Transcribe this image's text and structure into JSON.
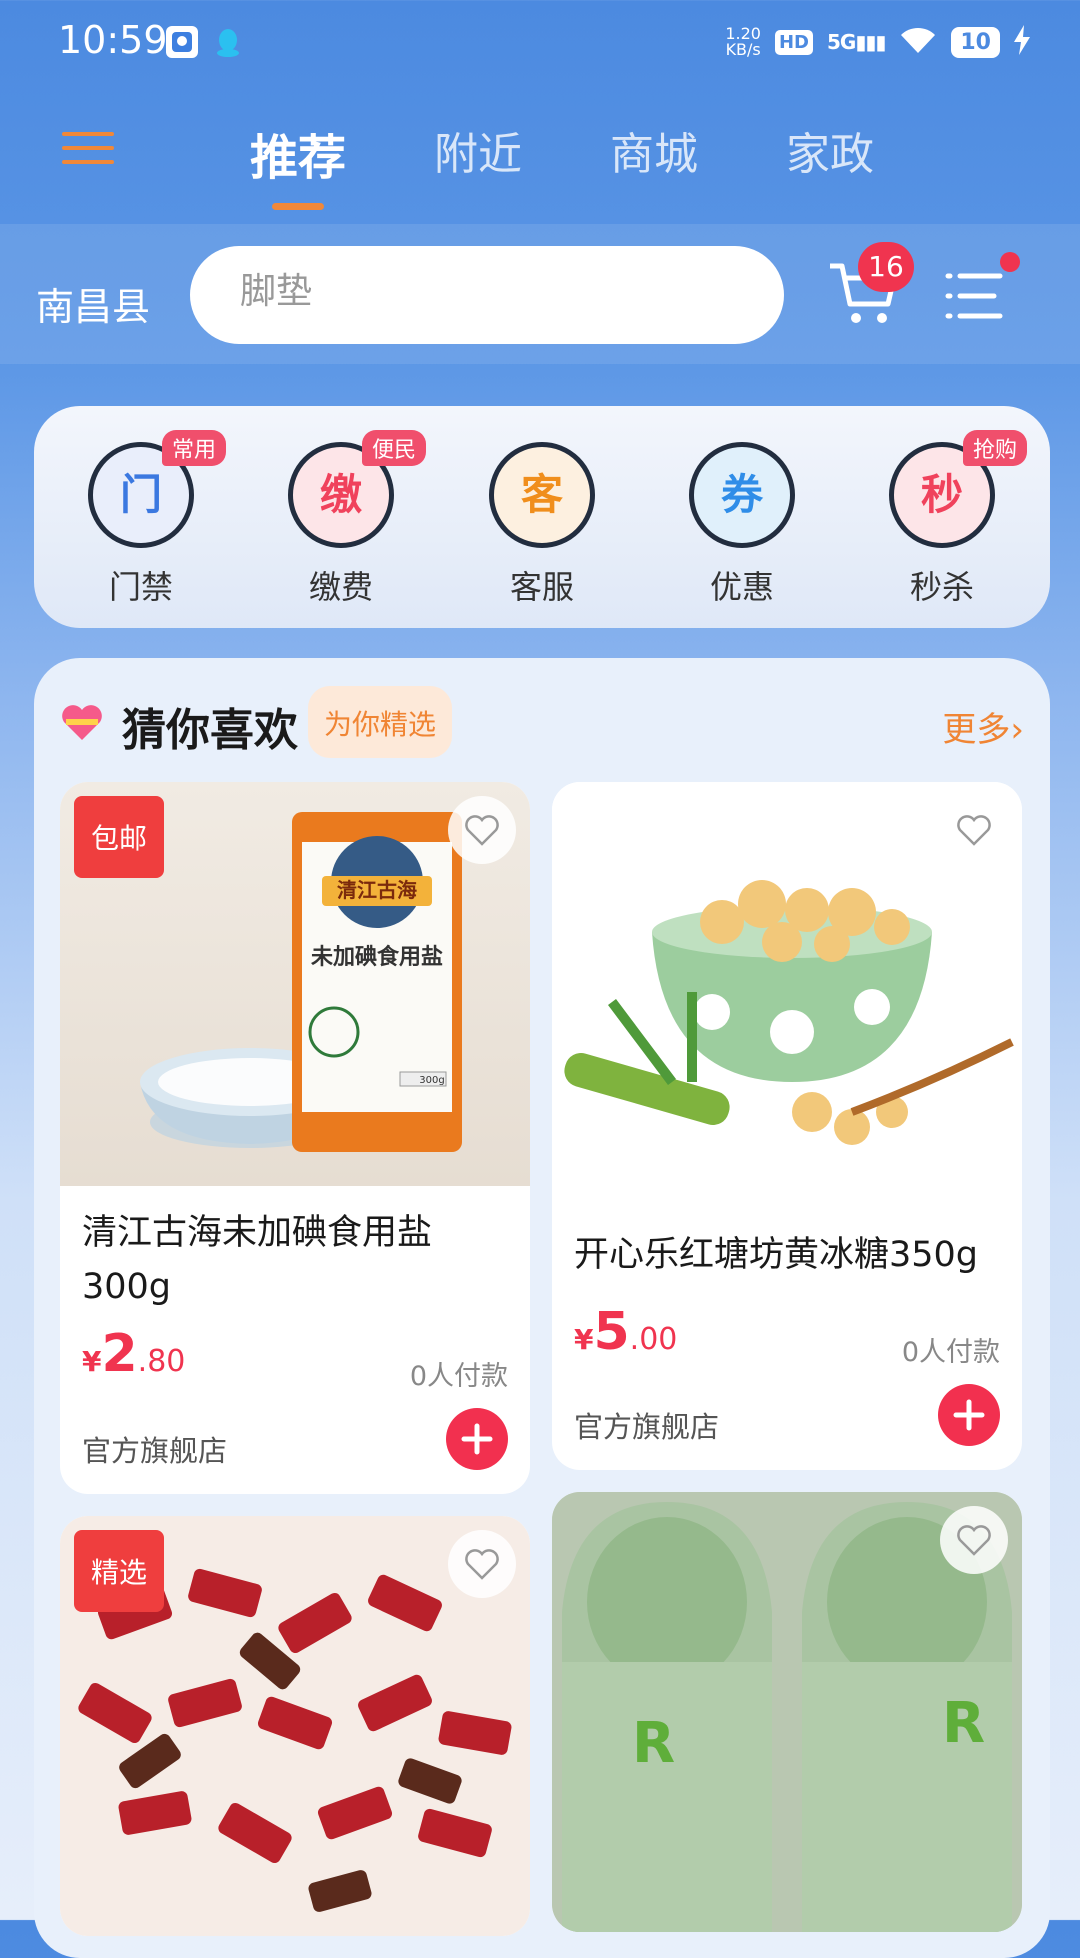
{
  "status_bar": {
    "time": "10:59",
    "net_speed_value": "1.20",
    "net_speed_unit": "KB/s",
    "hd": "HD",
    "signal": "5G",
    "battery": "10"
  },
  "top_tabs": [
    {
      "label": "推荐",
      "active": true
    },
    {
      "label": "附近",
      "active": false
    },
    {
      "label": "商城",
      "active": false
    },
    {
      "label": "家政",
      "active": false
    }
  ],
  "search_row": {
    "city": "南昌县",
    "search_placeholder": "脚垫",
    "cart_count": "16"
  },
  "quick_services": [
    {
      "glyph": "门",
      "label": "门禁",
      "tag": "常用",
      "color": "#3b78e0",
      "bg": "#e9eefb"
    },
    {
      "glyph": "缴",
      "label": "缴费",
      "tag": "便民",
      "color": "#f0425c",
      "bg": "#fde5e8"
    },
    {
      "glyph": "客",
      "label": "客服",
      "tag": "",
      "color": "#f08e1c",
      "bg": "#fdf0e0"
    },
    {
      "glyph": "券",
      "label": "优惠",
      "tag": "",
      "color": "#2f8de8",
      "bg": "#e0f0fb"
    },
    {
      "glyph": "秒",
      "label": "秒杀",
      "tag": "抢购",
      "color": "#f0425c",
      "bg": "#fde5e8"
    }
  ],
  "recommend": {
    "title": "猜你喜欢",
    "subtitle": "为你精选",
    "more": "更多›",
    "products": [
      {
        "tag": "包邮",
        "name": "清江古海未加碘食用盐300g",
        "price_symbol": "¥",
        "price_int": "2",
        "price_dec": ".80",
        "paid": "0人付款",
        "shop": "官方旗舰店",
        "package_brand": "清江古海",
        "package_text": "未加碘食用盐",
        "package_weight": "300g"
      },
      {
        "tag": "",
        "name": "开心乐红塘坊黄冰糖350g",
        "price_symbol": "¥",
        "price_int": "5",
        "price_dec": ".00",
        "paid": "0人付款",
        "shop": "官方旗舰店"
      },
      {
        "tag": "精选"
      },
      {
        "tag": ""
      }
    ]
  },
  "colors": {
    "accent_orange": "#f0883a",
    "price_red": "#f0344f",
    "header_blue": "#4c8ae0"
  }
}
